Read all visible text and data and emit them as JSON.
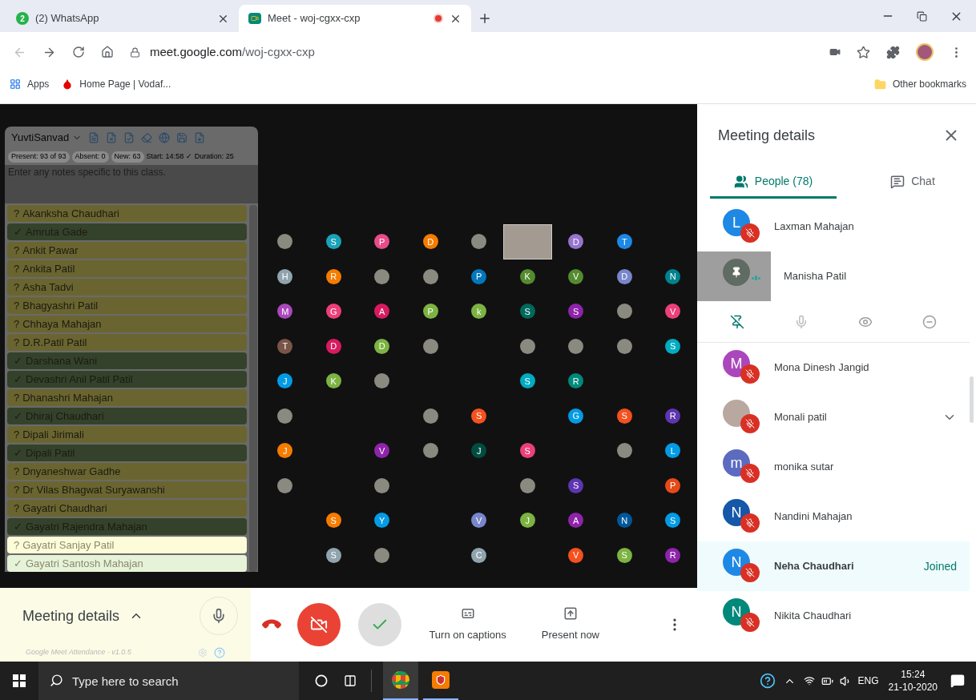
{
  "browser": {
    "tabs": [
      {
        "title": "(2) WhatsApp",
        "badge": "2",
        "selected": false,
        "recording": false
      },
      {
        "title": "Meet - woj-cgxx-cxp",
        "selected": true,
        "recording": true
      }
    ],
    "url_host": "meet.google.com",
    "url_path": "/woj-cgxx-cxp",
    "bookmarks": [
      {
        "label": "Apps",
        "kind": "apps"
      },
      {
        "label": "Home Page | Vodaf...",
        "kind": "site"
      }
    ],
    "other_bookmarks": "Other bookmarks"
  },
  "attendance": {
    "class_name": "YuvtiSanvad",
    "stats": [
      {
        "text": "Present: 93 of 93",
        "kind": "chip"
      },
      {
        "text": "Absent: 0",
        "kind": "chip"
      },
      {
        "text": "New: 63",
        "kind": "chip"
      },
      {
        "text": "Start: 14:58",
        "kind": "plain"
      },
      {
        "text": "✓ Duration: 25",
        "kind": "plain"
      }
    ],
    "notes_placeholder": "Enter any notes specific to this class.",
    "students": [
      {
        "mark": "?",
        "name": "Akanksha Chaudhari",
        "present": false,
        "faded": false
      },
      {
        "mark": "✓",
        "name": "Amruta Gade",
        "present": true,
        "faded": false
      },
      {
        "mark": "?",
        "name": "Ankit Pawar",
        "present": false,
        "faded": false
      },
      {
        "mark": "?",
        "name": "Ankita Patil",
        "present": false,
        "faded": false
      },
      {
        "mark": "?",
        "name": "Asha Tadvi",
        "present": false,
        "faded": false
      },
      {
        "mark": "?",
        "name": "Bhagyashri Patil",
        "present": false,
        "faded": false
      },
      {
        "mark": "?",
        "name": "Chhaya Mahajan",
        "present": false,
        "faded": false
      },
      {
        "mark": "?",
        "name": "D.R.Patil Patil",
        "present": false,
        "faded": false
      },
      {
        "mark": "✓",
        "name": "Darshana Wani",
        "present": true,
        "faded": false
      },
      {
        "mark": "✓",
        "name": "Devashri Anil Patil Patil",
        "present": true,
        "faded": false
      },
      {
        "mark": "?",
        "name": "Dhanashri Mahajan",
        "present": false,
        "faded": false
      },
      {
        "mark": "✓",
        "name": "Dhiraj Chaudhari",
        "present": true,
        "faded": false
      },
      {
        "mark": "?",
        "name": "Dipali Jirimali",
        "present": false,
        "faded": false
      },
      {
        "mark": "✓",
        "name": "Dipali Patil",
        "present": true,
        "faded": false
      },
      {
        "mark": "?",
        "name": "Dnyaneshwar Gadhe",
        "present": false,
        "faded": false
      },
      {
        "mark": "?",
        "name": "Dr Vilas Bhagwat Suryawanshi",
        "present": false,
        "faded": false
      },
      {
        "mark": "?",
        "name": "Gayatri Chaudhari",
        "present": false,
        "faded": false
      },
      {
        "mark": "✓",
        "name": "Gayatri Rajendra Mahajan",
        "present": true,
        "faded": false
      },
      {
        "mark": "?",
        "name": "Gayatri Sanjay Patil",
        "present": false,
        "faded": true
      },
      {
        "mark": "✓",
        "name": "Gayatri Santosh Mahajan",
        "present": true,
        "faded": true
      }
    ],
    "footer": "Google Meet Attendance - v1.0.5"
  },
  "grid": {
    "rows": [
      [
        {
          "kind": "photo"
        },
        {
          "kind": "letter",
          "text": "S",
          "color": "#1aa3b8"
        },
        {
          "kind": "letter",
          "text": "P",
          "color": "#e84c8b"
        },
        {
          "kind": "letter",
          "text": "D",
          "color": "#f57c00"
        },
        {
          "kind": "photo"
        },
        {
          "kind": "video"
        },
        {
          "kind": "letter",
          "text": "D",
          "color": "#9575cd"
        },
        {
          "kind": "letter",
          "text": "T",
          "color": "#1e88e5"
        },
        {
          "kind": "empty"
        }
      ],
      [
        {
          "kind": "letter",
          "text": "H",
          "color": "#90a4ae"
        },
        {
          "kind": "letter",
          "text": "R",
          "color": "#f57c00"
        },
        {
          "kind": "photo"
        },
        {
          "kind": "photo"
        },
        {
          "kind": "letter",
          "text": "P",
          "color": "#0277bd"
        },
        {
          "kind": "letter",
          "text": "K",
          "color": "#558b2f"
        },
        {
          "kind": "letter",
          "text": "V",
          "color": "#558b2f"
        },
        {
          "kind": "letter",
          "text": "D",
          "color": "#7986cb"
        },
        {
          "kind": "letter",
          "text": "N",
          "color": "#00838f"
        }
      ],
      [
        {
          "kind": "letter",
          "text": "M",
          "color": "#ab47bc"
        },
        {
          "kind": "letter",
          "text": "G",
          "color": "#ec407a"
        },
        {
          "kind": "letter",
          "text": "A",
          "color": "#d81b60"
        },
        {
          "kind": "letter",
          "text": "P",
          "color": "#7cb342"
        },
        {
          "kind": "letter",
          "text": "k",
          "color": "#7cb342"
        },
        {
          "kind": "letter",
          "text": "S",
          "color": "#00695c"
        },
        {
          "kind": "letter",
          "text": "S",
          "color": "#8e24aa"
        },
        {
          "kind": "photo"
        },
        {
          "kind": "letter",
          "text": "V",
          "color": "#ec407a"
        }
      ],
      [
        {
          "kind": "letter",
          "text": "T",
          "color": "#795548"
        },
        {
          "kind": "letter",
          "text": "D",
          "color": "#d81b60"
        },
        {
          "kind": "letter",
          "text": "D",
          "color": "#7cb342"
        },
        {
          "kind": "photo"
        },
        {
          "kind": "empty"
        },
        {
          "kind": "photo"
        },
        {
          "kind": "photo"
        },
        {
          "kind": "photo"
        },
        {
          "kind": "letter",
          "text": "S",
          "color": "#00acc1"
        }
      ],
      [
        {
          "kind": "letter",
          "text": "J",
          "color": "#039be5"
        },
        {
          "kind": "letter",
          "text": "K",
          "color": "#7cb342"
        },
        {
          "kind": "photo"
        },
        {
          "kind": "empty"
        },
        {
          "kind": "empty"
        },
        {
          "kind": "letter",
          "text": "S",
          "color": "#00acc1"
        },
        {
          "kind": "letter",
          "text": "R",
          "color": "#00897b"
        },
        {
          "kind": "empty"
        },
        {
          "kind": "empty"
        }
      ],
      [
        {
          "kind": "photo"
        },
        {
          "kind": "empty"
        },
        {
          "kind": "empty"
        },
        {
          "kind": "photo"
        },
        {
          "kind": "letter",
          "text": "S",
          "color": "#f4511e"
        },
        {
          "kind": "empty"
        },
        {
          "kind": "letter",
          "text": "G",
          "color": "#039be5"
        },
        {
          "kind": "letter",
          "text": "S",
          "color": "#f4511e"
        },
        {
          "kind": "letter",
          "text": "R",
          "color": "#5e35b1"
        }
      ],
      [
        {
          "kind": "letter",
          "text": "J",
          "color": "#f57c00"
        },
        {
          "kind": "empty"
        },
        {
          "kind": "letter",
          "text": "V",
          "color": "#8e24aa"
        },
        {
          "kind": "photo"
        },
        {
          "kind": "letter",
          "text": "J",
          "color": "#004d40"
        },
        {
          "kind": "letter",
          "text": "S",
          "color": "#ec407a"
        },
        {
          "kind": "empty"
        },
        {
          "kind": "photo"
        },
        {
          "kind": "letter",
          "text": "L",
          "color": "#039be5"
        }
      ],
      [
        {
          "kind": "photo"
        },
        {
          "kind": "empty"
        },
        {
          "kind": "photo"
        },
        {
          "kind": "empty"
        },
        {
          "kind": "empty"
        },
        {
          "kind": "photo"
        },
        {
          "kind": "letter",
          "text": "S",
          "color": "#5e35b1"
        },
        {
          "kind": "empty"
        },
        {
          "kind": "letter",
          "text": "P",
          "color": "#e64a19"
        }
      ],
      [
        {
          "kind": "empty"
        },
        {
          "kind": "letter",
          "text": "S",
          "color": "#f57c00"
        },
        {
          "kind": "letter",
          "text": "Y",
          "color": "#039be5"
        },
        {
          "kind": "empty"
        },
        {
          "kind": "letter",
          "text": "V",
          "color": "#7986cb"
        },
        {
          "kind": "letter",
          "text": "J",
          "color": "#7cb342"
        },
        {
          "kind": "letter",
          "text": "A",
          "color": "#8e24aa"
        },
        {
          "kind": "letter",
          "text": "N",
          "color": "#01579b"
        },
        {
          "kind": "letter",
          "text": "S",
          "color": "#039be5"
        }
      ],
      [
        {
          "kind": "empty"
        },
        {
          "kind": "letter",
          "text": "S",
          "color": "#90a4ae"
        },
        {
          "kind": "photo"
        },
        {
          "kind": "empty"
        },
        {
          "kind": "letter",
          "text": "C",
          "color": "#90a4ae"
        },
        {
          "kind": "empty"
        },
        {
          "kind": "letter",
          "text": "V",
          "color": "#f4511e"
        },
        {
          "kind": "letter",
          "text": "S",
          "color": "#7cb342"
        },
        {
          "kind": "letter",
          "text": "R",
          "color": "#8e24aa"
        }
      ]
    ]
  },
  "controls": {
    "details_label": "Meeting details",
    "mic_on": true,
    "camera_on": false,
    "captions": "Turn on captions",
    "present": "Present now"
  },
  "panel": {
    "title": "Meeting details",
    "tabs": [
      {
        "label": "People (78)",
        "kind": "people",
        "selected": true
      },
      {
        "label": "Chat",
        "kind": "chat",
        "selected": false
      }
    ],
    "participants": [
      {
        "name": "Laxman Mahajan",
        "avatar": {
          "kind": "letter",
          "initial": "L",
          "color": "#1e88e5"
        },
        "muted": true,
        "pinned": false,
        "hovered": false
      },
      {
        "name": "Manisha Patil",
        "avatar": {
          "kind": "blank",
          "color": "#5f6b63"
        },
        "muted": false,
        "pinned": true,
        "hovered": false
      },
      {
        "name": "Mona Dinesh Jangid",
        "avatar": {
          "kind": "letter",
          "initial": "M",
          "color": "#ab47bc"
        },
        "muted": true,
        "pinned": false,
        "hovered": false
      },
      {
        "name": "Monali patil",
        "avatar": {
          "kind": "photo"
        },
        "muted": true,
        "pinned": false,
        "hovered": true
      },
      {
        "name": "monika sutar",
        "avatar": {
          "kind": "letter",
          "initial": "m",
          "color": "#5c6bc0"
        },
        "muted": true,
        "pinned": false,
        "hovered": false
      },
      {
        "name": "Nandini Mahajan",
        "avatar": {
          "kind": "letter",
          "initial": "N",
          "color": "#1557a8"
        },
        "muted": true,
        "pinned": false,
        "hovered": false
      },
      {
        "name": "Neha Chaudhari",
        "avatar": {
          "kind": "letter",
          "initial": "N",
          "color": "#1e88e5"
        },
        "muted": true,
        "pinned": false,
        "hovered": false,
        "status": "Joined"
      },
      {
        "name": "Nikita Chaudhari",
        "avatar": {
          "kind": "letter",
          "initial": "N",
          "color": "#00897b"
        },
        "muted": true,
        "pinned": false,
        "hovered": false
      }
    ]
  },
  "taskbar": {
    "search_placeholder": "Type here to search",
    "language": "ENG",
    "time": "15:24",
    "date": "21-10-2020"
  }
}
